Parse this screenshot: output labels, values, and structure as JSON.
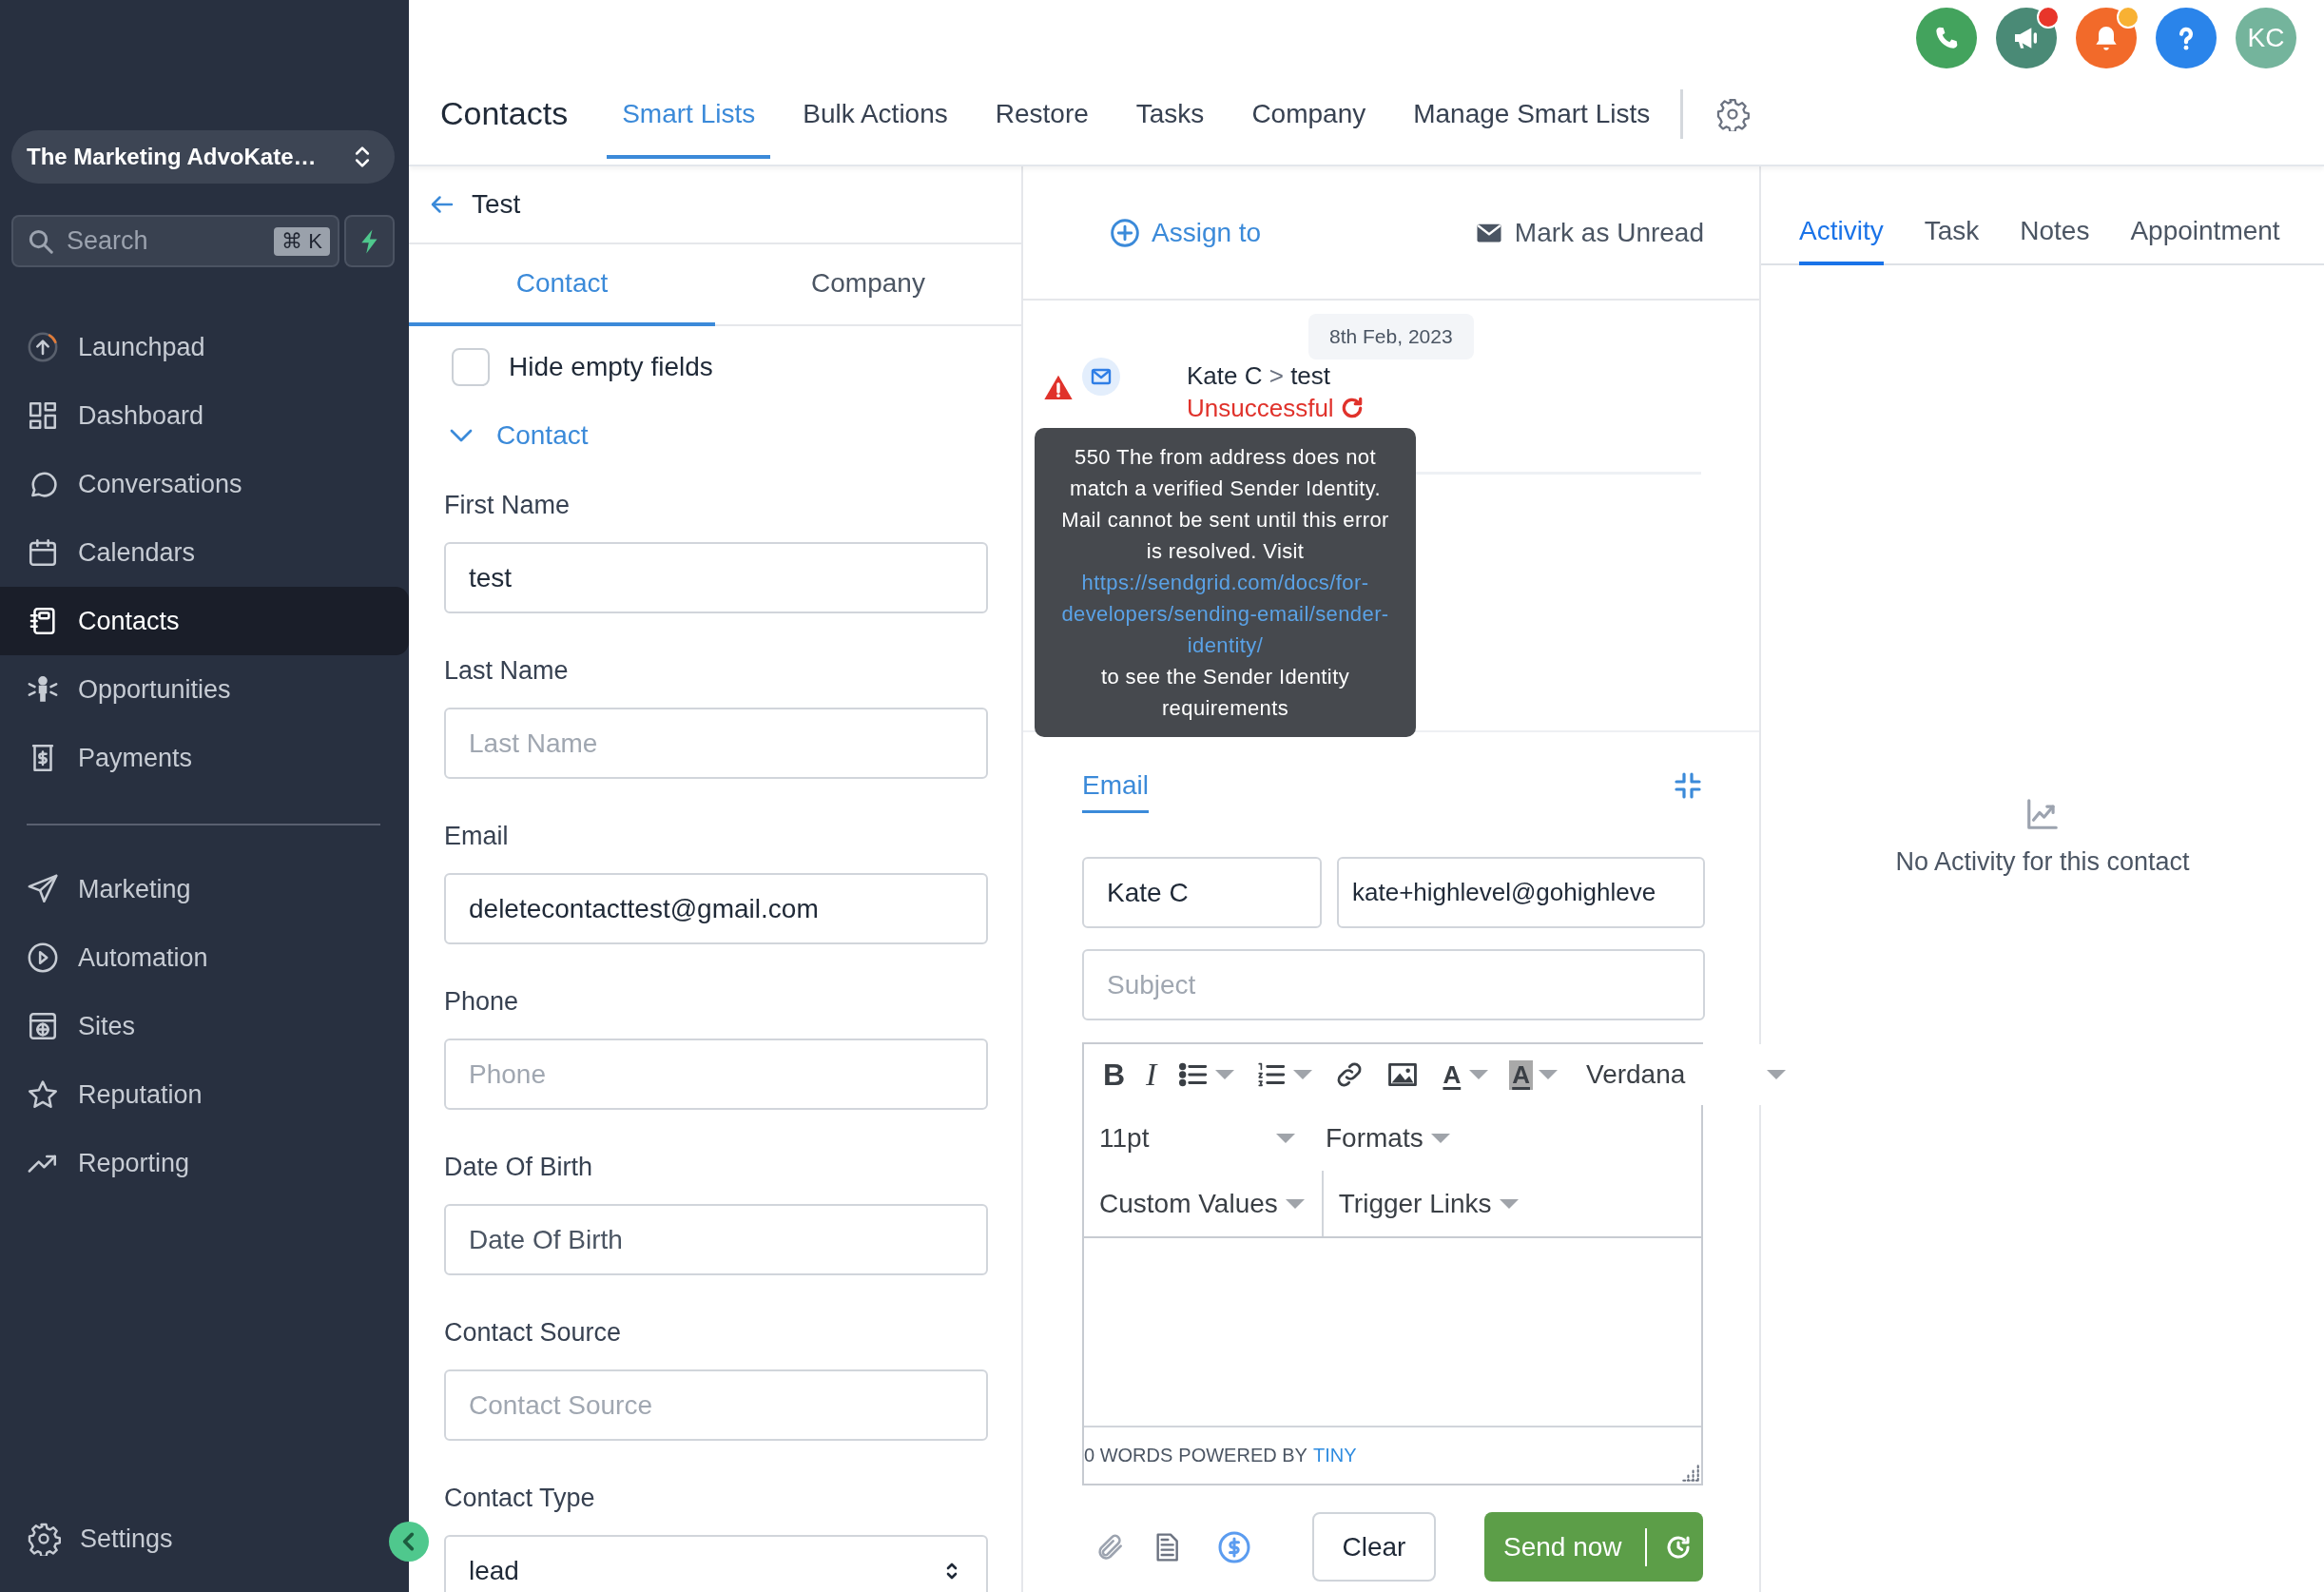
{
  "sidebar": {
    "account": "The Marketing AdvoKate…",
    "search": {
      "placeholder": "Search",
      "shortcut": "⌘ K"
    },
    "items": [
      {
        "kind": "launchpad",
        "label": "Launchpad",
        "selected": false
      },
      {
        "kind": "dashboard",
        "label": "Dashboard",
        "selected": false
      },
      {
        "kind": "conversations",
        "label": "Conversations",
        "selected": false
      },
      {
        "kind": "calendars",
        "label": "Calendars",
        "selected": false
      },
      {
        "kind": "contacts",
        "label": "Contacts",
        "selected": true
      },
      {
        "kind": "opportunities",
        "label": "Opportunities",
        "selected": false
      },
      {
        "kind": "payments",
        "label": "Payments",
        "selected": false
      }
    ],
    "secondary_items": [
      {
        "kind": "marketing",
        "label": "Marketing",
        "selected": false
      },
      {
        "kind": "automation",
        "label": "Automation",
        "selected": false
      },
      {
        "kind": "sites",
        "label": "Sites",
        "selected": false
      },
      {
        "kind": "reputation",
        "label": "Reputation",
        "selected": false
      },
      {
        "kind": "reporting",
        "label": "Reporting",
        "selected": false
      }
    ],
    "settings": "Settings"
  },
  "top_actions": [
    {
      "kind": "phone",
      "color": "#43a35d"
    },
    {
      "kind": "megaphone",
      "color": "#4a8a76",
      "badge": {
        "color": "#e8352a"
      }
    },
    {
      "kind": "bell",
      "color": "#f26a2a",
      "badge": {
        "color": "#f8b133"
      }
    },
    {
      "kind": "help",
      "color": "#2a84ea"
    },
    {
      "kind": "avatar",
      "color": "#74b49c",
      "text": "KC"
    }
  ],
  "header": {
    "title": "Contacts",
    "tabs": [
      {
        "label": "Smart Lists",
        "selected": true
      },
      {
        "label": "Bulk Actions",
        "selected": false
      },
      {
        "label": "Restore",
        "selected": false
      },
      {
        "label": "Tasks",
        "selected": false
      },
      {
        "label": "Company",
        "selected": false
      },
      {
        "label": "Manage Smart Lists",
        "selected": false
      }
    ]
  },
  "contact_panel": {
    "back_label": "Test",
    "tabs": [
      {
        "label": "Contact",
        "selected": true
      },
      {
        "label": "Company",
        "selected": false
      }
    ],
    "hide_empty": {
      "label": "Hide empty fields",
      "checked": false
    },
    "section": {
      "label": "Contact",
      "expanded": true
    },
    "fields": [
      {
        "kind": "text",
        "label": "First Name",
        "value": "test"
      },
      {
        "kind": "text",
        "label": "Last Name",
        "placeholder": "Last Name"
      },
      {
        "kind": "text",
        "label": "Email",
        "value": "deletecontacttest@gmail.com"
      },
      {
        "kind": "text",
        "label": "Phone",
        "placeholder": "Phone"
      },
      {
        "kind": "date",
        "label": "Date Of Birth",
        "placeholder": "Date Of Birth"
      },
      {
        "kind": "text",
        "label": "Contact Source",
        "placeholder": "Contact Source"
      },
      {
        "kind": "select",
        "label": "Contact Type",
        "value": "lead"
      }
    ]
  },
  "conversation": {
    "actions": [
      {
        "kind": "assign",
        "label": "Assign to"
      },
      {
        "kind": "unread",
        "label": "Mark as Unread"
      }
    ],
    "message": {
      "date": "8th Feb, 2023",
      "sender": "Kate C",
      "separator": ">",
      "subject": "test",
      "status": "Unsuccessful",
      "error": {
        "text": "550 The from address does not match a verified Sender Identity. Mail cannot be sent until this error is resolved. Visit",
        "link": "https://sendgrid.com/docs/for-developers/sending-email/sender-identity/",
        "after": "to see the Sender Identity requirements"
      }
    },
    "composer": {
      "tabs": [
        {
          "label": "Email",
          "selected": true
        }
      ],
      "from_name": "Kate C",
      "to_email": "kate+highlevel@gohighleve",
      "subject_placeholder": "Subject",
      "toolbar": [
        {
          "kind": "bold",
          "label": "B",
          "dropdown": false
        },
        {
          "kind": "italic",
          "label": "I",
          "dropdown": false
        },
        {
          "kind": "bullets",
          "dropdown": true
        },
        {
          "kind": "numbers",
          "dropdown": true
        },
        {
          "kind": "link",
          "dropdown": false
        },
        {
          "kind": "image",
          "dropdown": false
        },
        {
          "kind": "text-color",
          "label": "A",
          "dropdown": true
        },
        {
          "kind": "highlight",
          "label": "A",
          "dropdown": true
        },
        {
          "kind": "font",
          "label": "Verdana",
          "dropdown": true
        }
      ],
      "font_size": "11pt",
      "formats": "Formats",
      "custom_values": "Custom Values",
      "trigger_links": "Trigger Links",
      "word_count": "0 WORDS",
      "powered_by": "POWERED BY",
      "brand": "TINY",
      "clear": "Clear",
      "send": "Send now"
    }
  },
  "activity": {
    "tabs": [
      {
        "label": "Activity",
        "selected": true
      },
      {
        "label": "Task",
        "selected": false
      },
      {
        "label": "Notes",
        "selected": false
      },
      {
        "label": "Appointment",
        "selected": false
      }
    ],
    "empty": "No Activity for this contact"
  }
}
